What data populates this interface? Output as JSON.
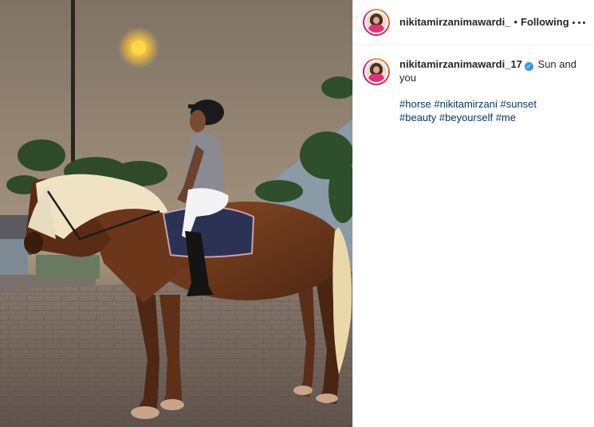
{
  "header": {
    "username": "nikitamirzanimawardi_",
    "separator": "•",
    "follow_status": "Following"
  },
  "caption": {
    "username": "nikitamirzanimawardi_17",
    "verified_mark": "✓",
    "text": "Sun and you",
    "hashtags": [
      "#horse",
      "#nikitamirzani",
      "#sunset",
      "#beauty",
      "#beyourself",
      "#me"
    ]
  },
  "colors": {
    "link": "#00376b",
    "verified": "#3897f0",
    "divider": "#efefef"
  },
  "icons": {
    "more_options": "more-options-icon",
    "verified_badge": "verified-badge-icon"
  }
}
